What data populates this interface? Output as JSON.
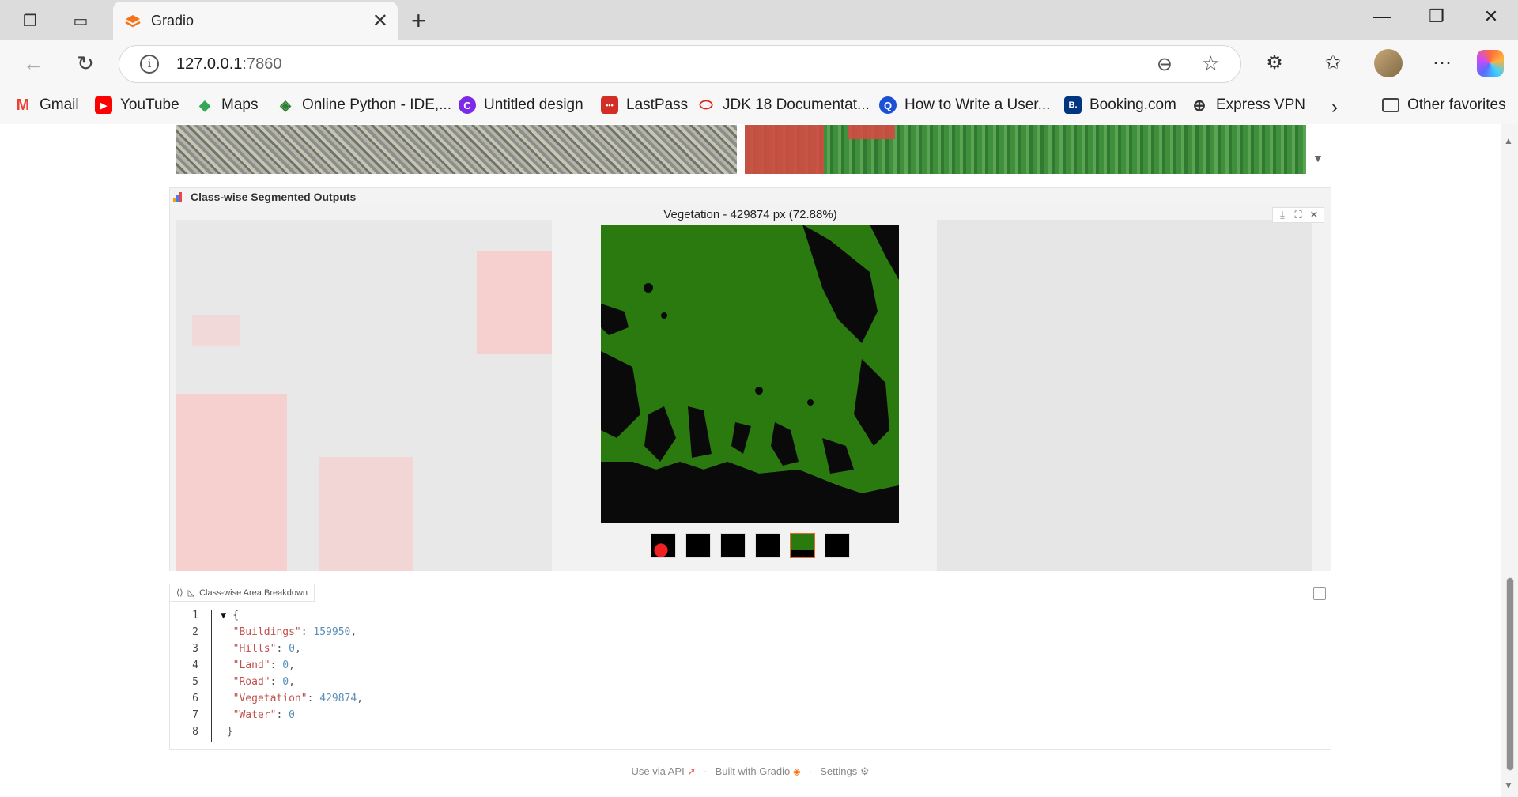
{
  "browser": {
    "tab_title": "Gradio",
    "url_host": "127.0.0.1",
    "url_port": ":7860",
    "favorites": [
      {
        "label": "Gmail",
        "icon": "gmail-icon",
        "color": "#ea4335",
        "glyph": "M"
      },
      {
        "label": "YouTube",
        "icon": "youtube-icon",
        "color": "#ff0000",
        "glyph": "▶"
      },
      {
        "label": "Maps",
        "icon": "maps-icon",
        "color": "#34a853",
        "glyph": "◆"
      },
      {
        "label": "Online Python - IDE,...",
        "icon": "python-ide-icon",
        "color": "#2e7d32",
        "glyph": "◈"
      },
      {
        "label": "Untitled design",
        "icon": "canva-icon",
        "color": "#7d2ae8",
        "glyph": "C"
      },
      {
        "label": "LastPass",
        "icon": "lastpass-icon",
        "color": "#d32d27",
        "glyph": "•••"
      },
      {
        "label": "JDK 18 Documentat...",
        "icon": "oracle-icon",
        "color": "#ffffff",
        "glyph": "⬭"
      },
      {
        "label": "How to Write a User...",
        "icon": "search-site-icon",
        "color": "#1a4fd6",
        "glyph": "Q"
      },
      {
        "label": "Booking.com",
        "icon": "booking-icon",
        "color": "#003580",
        "glyph": "B."
      },
      {
        "label": "Express VPN",
        "icon": "globe-icon",
        "color": "#ffffff",
        "glyph": "⊕"
      }
    ],
    "other_favorites": "Other favorites"
  },
  "gallery": {
    "label": "Class-wise Segmented Outputs",
    "caption": "Vegetation - 429874 px (72.88%)",
    "thumbnails": [
      "buildings",
      "hills",
      "land",
      "road",
      "vegetation",
      "water"
    ],
    "selected_thumbnail": "vegetation"
  },
  "json_panel": {
    "label": "Class-wise Area Breakdown",
    "line_numbers": [
      "1",
      "2",
      "3",
      "4",
      "5",
      "6",
      "7",
      "8"
    ],
    "entries": [
      {
        "key": "\"Buildings\"",
        "value": "159950",
        "comma": ","
      },
      {
        "key": "\"Hills\"",
        "value": "0",
        "comma": ","
      },
      {
        "key": "\"Land\"",
        "value": "0",
        "comma": ","
      },
      {
        "key": "\"Road\"",
        "value": "0",
        "comma": ","
      },
      {
        "key": "\"Vegetation\"",
        "value": "429874",
        "comma": ","
      },
      {
        "key": "\"Water\"",
        "value": "0",
        "comma": ""
      }
    ],
    "open_brace": "{",
    "close_brace": "}"
  },
  "footer": {
    "api": "Use via API",
    "built": "Built with Gradio",
    "settings": "Settings",
    "sep": "·"
  },
  "colors": {
    "vegetation_green": "#2a7a0f",
    "selection_orange": "#e06b2a",
    "json_key": "#c0504d",
    "json_number": "#5a8fb8"
  }
}
